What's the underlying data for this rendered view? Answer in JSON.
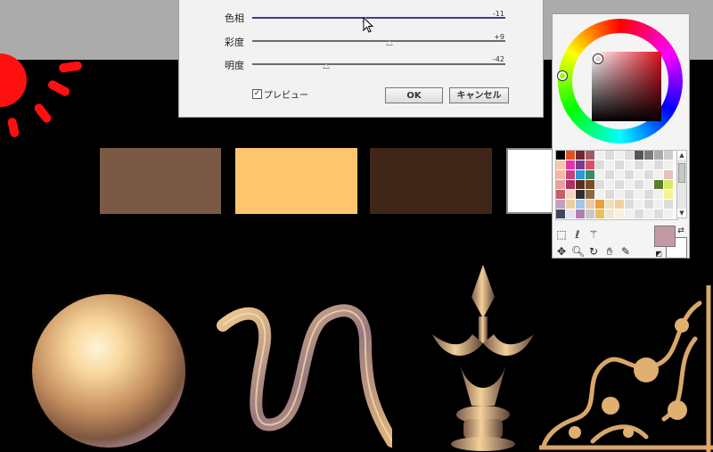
{
  "dialog": {
    "sliders": [
      {
        "label": "色相",
        "value": "-11",
        "position": 0.44
      },
      {
        "label": "彩度",
        "value": "+9",
        "position": 0.54
      },
      {
        "label": "明度",
        "value": "-42",
        "position": 0.3
      }
    ],
    "preview_label": "プレビュー",
    "preview_checked": true,
    "ok_label": "OK",
    "cancel_label": "キャンセル"
  },
  "color_panel": {
    "main_color": "#c29aa3",
    "sub_color": "#ffffff",
    "wheel_hue_color": "#e0101f",
    "tools": [
      "selection-icon",
      "lasso-icon",
      "magic-wand-icon",
      "move-icon",
      "zoom-icon",
      "rotate-icon",
      "hand-icon",
      "eyedropper-icon"
    ]
  },
  "canvas": {
    "swatch_colors": [
      "#7a5a45",
      "#fcc56e",
      "#3f2618",
      "#ffffff"
    ]
  }
}
